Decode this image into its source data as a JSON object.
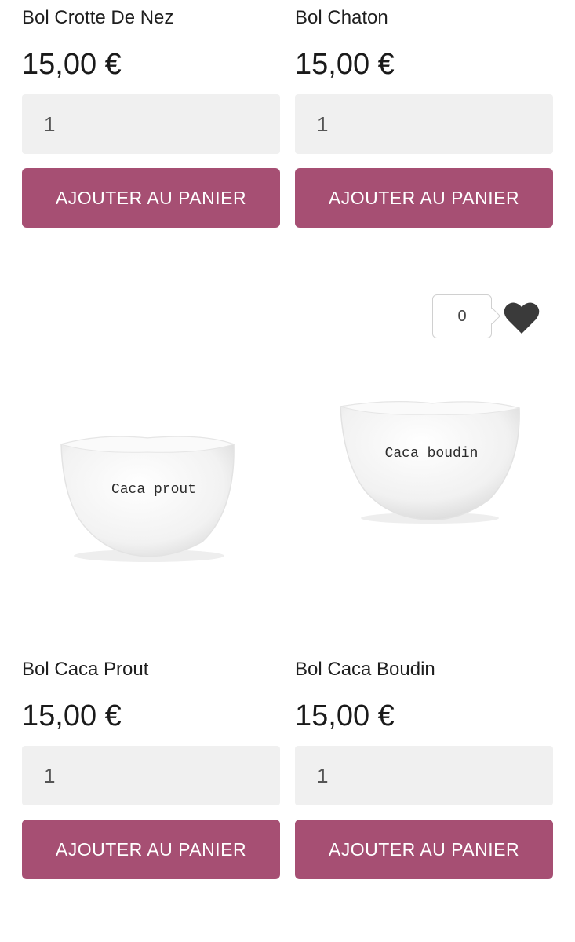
{
  "products_top": [
    {
      "name": "Bol Crotte De Nez",
      "price": "15,00 €",
      "quantity": "1",
      "add_label": "AJOUTER AU PANIER"
    },
    {
      "name": "Bol Chaton",
      "price": "15,00 €",
      "quantity": "1",
      "add_label": "AJOUTER AU PANIER"
    }
  ],
  "products_bottom": [
    {
      "name": "Bol Caca Prout",
      "price": "15,00 €",
      "quantity": "1",
      "add_label": "AJOUTER AU PANIER",
      "bowl_text": "Caca prout"
    },
    {
      "name": "Bol Caca Boudin",
      "price": "15,00 €",
      "quantity": "1",
      "add_label": "AJOUTER AU PANIER",
      "bowl_text": "Caca boudin"
    }
  ],
  "wishlist": {
    "count": "0",
    "icon": "heart-icon"
  },
  "colors": {
    "accent": "#a64f73",
    "input_bg": "#f0f0f0",
    "heart": "#3a3a3a"
  }
}
